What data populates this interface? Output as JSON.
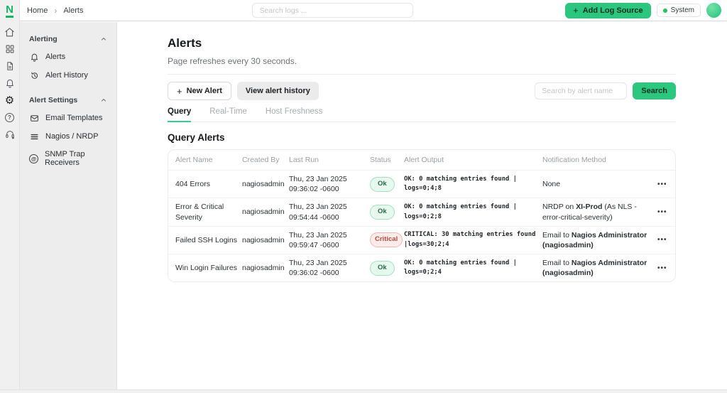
{
  "colors": {
    "accent_green": "#2bc77f",
    "logo_green": "#10b662",
    "status_ok_bg": "#e7f8ef",
    "status_ok_text": "#256c4b",
    "status_critical_bg": "#fbece9",
    "status_critical_text": "#b94a3e"
  },
  "topbar": {
    "logo_letter": "N",
    "breadcrumb": {
      "home": "Home",
      "current": "Alerts"
    },
    "search_placeholder": "Search logs ...",
    "add_log_source_label": "Add Log Source",
    "system_label": "System"
  },
  "rail_icons": [
    "home-icon",
    "apps-icon",
    "document-icon",
    "bell-icon",
    "gear-icon",
    "help-icon",
    "support-icon"
  ],
  "sidebar": {
    "sections": [
      {
        "label": "Alerting",
        "items": [
          {
            "icon": "bell-icon",
            "label": "Alerts"
          },
          {
            "icon": "history-icon",
            "label": "Alert History"
          }
        ]
      },
      {
        "label": "Alert Settings",
        "items": [
          {
            "icon": "envelope-icon",
            "label": "Email Templates"
          },
          {
            "icon": "list-icon",
            "label": "Nagios / NRDP"
          },
          {
            "icon": "at-icon",
            "label": "SNMP Trap Receivers"
          }
        ]
      }
    ]
  },
  "main": {
    "title": "Alerts",
    "subtitle": "Page refreshes every 30 seconds.",
    "buttons": {
      "new_alert": "New Alert",
      "view_alert_history": "View alert history",
      "search": "Search"
    },
    "alert_search_placeholder": "Search by alert name",
    "tabs": [
      {
        "label": "Query",
        "active": true
      },
      {
        "label": "Real-Time",
        "active": false
      },
      {
        "label": "Host Freshness",
        "active": false
      }
    ],
    "section_title": "Query Alerts"
  },
  "table": {
    "headers": [
      "Alert Name",
      "Created By",
      "Last Run",
      "Status",
      "Alert Output",
      "Notification Method"
    ],
    "row_menu_glyph": "•••",
    "rows": [
      {
        "name": "404 Errors",
        "created_by": "nagiosadmin",
        "last_run_date": "Thu, 23 Jan 2025",
        "last_run_time": "09:36:02 -0600",
        "status": "Ok",
        "output": "OK: 0 matching entries found | logs=0;4;8",
        "notification": {
          "prefix": "None",
          "bold": "",
          "suffix": ""
        }
      },
      {
        "name": "Error & Critical Severity",
        "created_by": "nagiosadmin",
        "last_run_date": "Thu, 23 Jan 2025",
        "last_run_time": "09:54:44 -0600",
        "status": "Ok",
        "output": "OK: 0 matching entries found | logs=0;2;8",
        "notification": {
          "prefix": "NRDP on ",
          "bold": "XI-Prod",
          "suffix": " (As NLS - error-critical-severity)"
        }
      },
      {
        "name": "Failed SSH Logins",
        "created_by": "nagiosadmin",
        "last_run_date": "Thu, 23 Jan 2025",
        "last_run_time": "09:59:47 -0600",
        "status": "Critical",
        "output": "CRITICAL: 30 matching entries found |logs=30;2;4",
        "notification": {
          "prefix": "Email to ",
          "bold": "Nagios Administrator (nagiosadmin)",
          "suffix": ""
        }
      },
      {
        "name": "Win Login Failures",
        "created_by": "nagiosadmin",
        "last_run_date": "Thu, 23 Jan 2025",
        "last_run_time": "09:36:02 -0600",
        "status": "Ok",
        "output": "OK: 0 matching entries found | logs=0;2;4",
        "notification": {
          "prefix": "Email to ",
          "bold": "Nagios Administrator (nagiosadmin)",
          "suffix": ""
        }
      }
    ]
  }
}
